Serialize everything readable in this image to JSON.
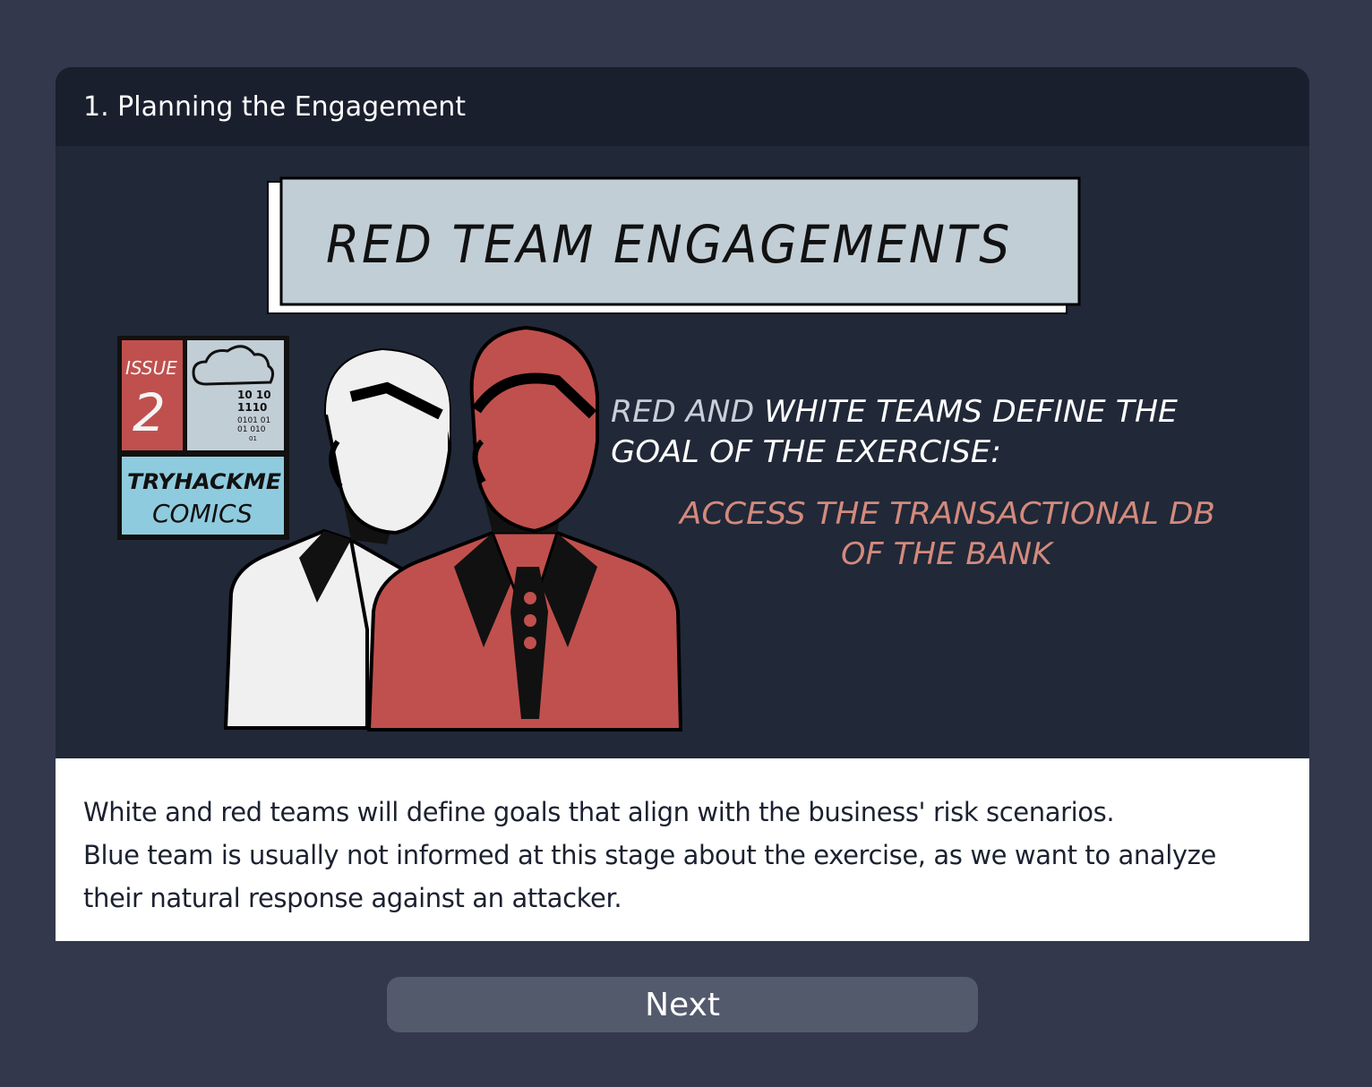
{
  "task": {
    "title": "1. Planning the Engagement"
  },
  "comic": {
    "banner_title": "RED TEAM ENGAGEMENTS",
    "issue_label": "ISSUE",
    "issue_number": "2",
    "binary_lines": [
      "10 10",
      "1110",
      "0101 01",
      "01 010",
      "01"
    ],
    "brand_line1": "TRYHACKME",
    "brand_line2": "COMICS",
    "caption_line1_part1": "RED AND ",
    "caption_line1_part2": "WHITE TEAMS DEFINE THE",
    "caption_line2": "GOAL OF THE EXERCISE:",
    "goal_line1": "ACCESS THE TRANSACTIONAL DB",
    "goal_line2": "OF THE BANK",
    "colors": {
      "red_suit": "#c0504d",
      "white_suit": "#f0f0f0",
      "banner_bg": "#c2ced6",
      "brand_bg": "#8fcbde",
      "goal_text": "#d38a7c"
    }
  },
  "description": {
    "line1": "White and red teams will define goals that align with the business' risk scenarios.",
    "line2": "Blue team is usually not informed at this stage about the exercise, as we want to analyze their natural response against an attacker."
  },
  "actions": {
    "next_label": "Next"
  }
}
